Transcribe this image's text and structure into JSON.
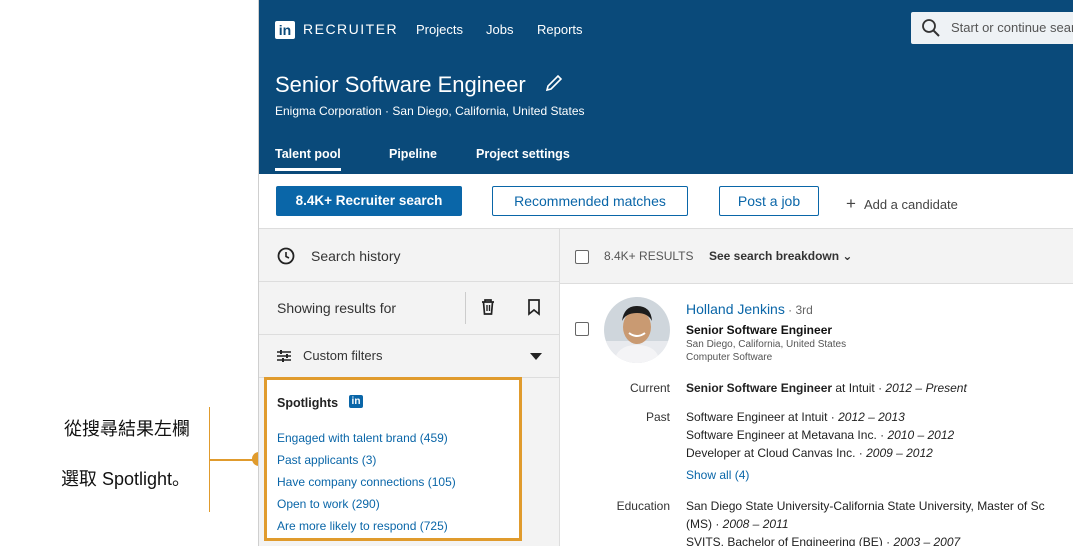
{
  "callout": {
    "line1": "從搜尋結果左欄",
    "line2": "選取 Spotlight。"
  },
  "topbar": {
    "logo": "in",
    "brand": "RECRUITER",
    "nav": [
      "Projects",
      "Jobs",
      "Reports"
    ],
    "search_placeholder": "Start or continue sear"
  },
  "header": {
    "title": "Senior Software Engineer",
    "subtitle": "Enigma Corporation  ·  San Diego, California, United States",
    "tabs": [
      "Talent pool",
      "Pipeline",
      "Project settings"
    ]
  },
  "actions": {
    "recruiter_search": "8.4K+ Recruiter search",
    "recommended": "Recommended matches",
    "post_job": "Post a job",
    "add_candidate": "Add a candidate"
  },
  "sidebar": {
    "search_history": "Search history",
    "showing_results": "Showing results for",
    "custom_filters": "Custom filters",
    "spotlights_title": "Spotlights",
    "spotlights": [
      "Engaged with talent brand (459)",
      "Past applicants (3)",
      "Have company connections (105)",
      "Open to work (290)",
      "Are more likely to respond (725)"
    ]
  },
  "results": {
    "count": "8.4K+ RESULTS",
    "breakdown": "See search breakdown",
    "candidate": {
      "name": "Holland Jenkins",
      "degree": " · 3rd",
      "headline": "Senior Software Engineer",
      "location": "San Diego, California, United States",
      "industry": "Computer Software",
      "current_label": "Current",
      "current_title": "Senior Software Engineer",
      "current_rest": " at Intuit · ",
      "current_dates": "2012 – Present",
      "past_label": "Past",
      "past": [
        {
          "text": "Software Engineer at Intuit · ",
          "dates": "2012 – 2013"
        },
        {
          "text": "Software Engineer at Metavana Inc. · ",
          "dates": "2010 – 2012"
        },
        {
          "text": "Developer at Cloud Canvas Inc. · ",
          "dates": "2009 – 2012"
        }
      ],
      "show_all": "Show all (4)",
      "education_label": "Education",
      "education_line1": "San Diego State University-California State University, Master of Sc",
      "education_line2_text": "(MS) · ",
      "education_line2_dates": "2008 – 2011",
      "education_line3": "SVITS, Bachelor of Engineering (BE) · ",
      "education_line3_dates": "2003 – 2007"
    }
  },
  "colors": {
    "brand_navy": "#0a4a7a",
    "link_blue": "#0a66a8",
    "highlight_orange": "#e09b2d"
  }
}
